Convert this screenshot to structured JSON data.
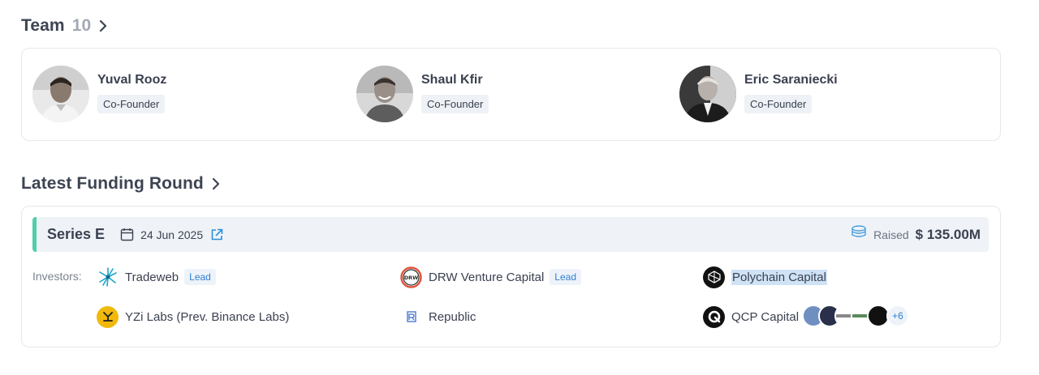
{
  "team": {
    "title": "Team",
    "count": "10",
    "members": [
      {
        "name": "Yuval Rooz",
        "role": "Co-Founder",
        "avatar": "person-photo"
      },
      {
        "name": "Shaul Kfir",
        "role": "Co-Founder",
        "avatar": "person-photo"
      },
      {
        "name": "Eric Saraniecki",
        "role": "Co-Founder",
        "avatar": "person-photo"
      }
    ]
  },
  "funding": {
    "title": "Latest Funding Round",
    "round": "Series E",
    "date": "24 Jun 2025",
    "raised_label": "Raised",
    "raised_value": "$ 135.00M",
    "accent_color": "#4fcfa9",
    "investors_label": "Investors:",
    "investors": [
      {
        "name": "Tradeweb",
        "badge": "Lead",
        "icon": "tradeweb-logo"
      },
      {
        "name": "DRW Venture Capital",
        "badge": "Lead",
        "icon": "drw-logo"
      },
      {
        "name": "Polychain Capital",
        "badge": "",
        "icon": "polychain-logo"
      },
      {
        "name": "YZi Labs (Prev. Binance Labs)",
        "badge": "",
        "icon": "yzi-logo"
      },
      {
        "name": "Republic",
        "badge": "",
        "icon": "republic-logo"
      },
      {
        "name": "QCP Capital",
        "badge": "",
        "icon": "qcp-logo"
      }
    ],
    "more_count": "+6"
  }
}
